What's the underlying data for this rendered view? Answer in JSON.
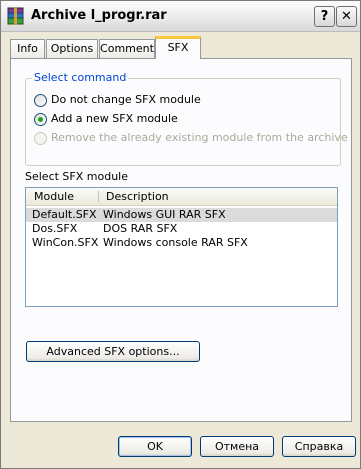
{
  "window": {
    "title": "Archive l_progr.rar",
    "help_glyph": "?",
    "close_glyph": "✕"
  },
  "tabs": [
    {
      "label": "Info"
    },
    {
      "label": "Options"
    },
    {
      "label": "Comment"
    },
    {
      "label": "SFX"
    }
  ],
  "active_tab": "SFX",
  "select_command": {
    "label": "Select command",
    "options": [
      {
        "label": "Do not change SFX module",
        "checked": false,
        "enabled": true
      },
      {
        "label": "Add a new SFX module",
        "checked": true,
        "enabled": true
      },
      {
        "label": "Remove the already existing module from the archive",
        "checked": false,
        "enabled": false
      }
    ]
  },
  "sfx_module": {
    "label": "Select SFX module",
    "columns": [
      "Module",
      "Description"
    ],
    "rows": [
      {
        "module": "Default.SFX",
        "description": "Windows GUI RAR SFX",
        "selected": true
      },
      {
        "module": "Dos.SFX",
        "description": "DOS RAR SFX",
        "selected": false
      },
      {
        "module": "WinCon.SFX",
        "description": "Windows console RAR SFX",
        "selected": false
      }
    ]
  },
  "advanced_button": "Advanced SFX options...",
  "buttons": {
    "ok": "OK",
    "cancel": "Отмена",
    "help": "Справка"
  },
  "colors": {
    "group_label": "#0046d5",
    "active_tab_accent": "#ffc83c",
    "radio_dot": "#21a121"
  }
}
